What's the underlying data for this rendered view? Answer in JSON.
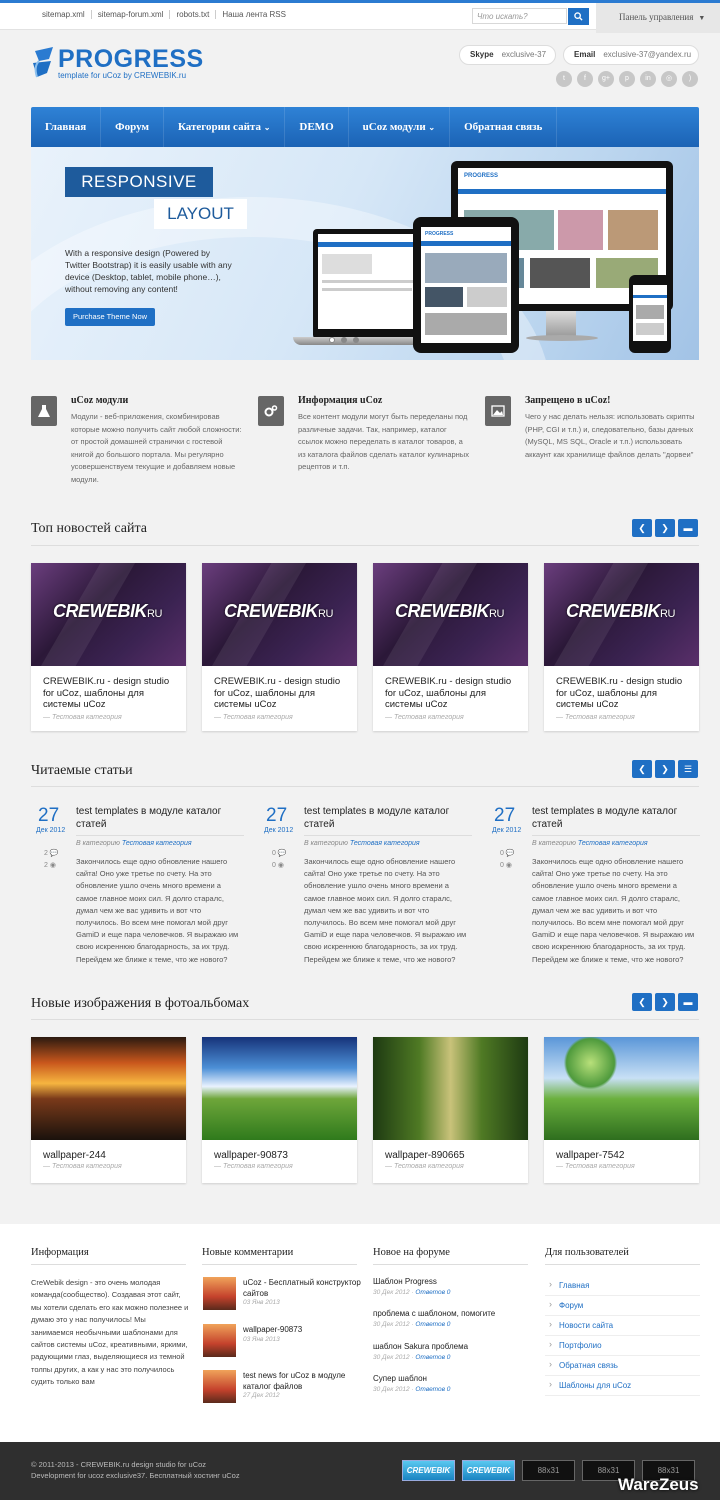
{
  "top": {
    "links": [
      "sitemap.xml",
      "sitemap-forum.xml",
      "robots.txt",
      "Наша лента RSS"
    ],
    "search_placeholder": "Что искать?",
    "panel_label": "Панель управления"
  },
  "brand": {
    "title": "PROGRESS",
    "subtitle": "template for uCoz by CREWEBIK.ru",
    "color": "#1f6fc4"
  },
  "contacts": {
    "skype_label": "Skype",
    "skype_value": "exclusive-37",
    "email_label": "Email",
    "email_value": "exclusive-37@yandex.ru"
  },
  "social_icons": [
    "twitter-icon",
    "facebook-icon",
    "google-plus-icon",
    "pinterest-icon",
    "linkedin-icon",
    "dribbble-icon",
    "rss-icon"
  ],
  "nav": [
    {
      "label": "Главная"
    },
    {
      "label": "Форум"
    },
    {
      "label": "Категории сайта"
    },
    {
      "label": "DEMO"
    },
    {
      "label": "uCoz модули"
    },
    {
      "label": "Обратная связь"
    }
  ],
  "hero": {
    "line1": "RESPONSIVE",
    "line2": "LAYOUT",
    "text": "With a responsive design (Powered by Twitter Bootstrap) it is easily usable with any device (Desktop, tablet, mobile phone…), without removing any content!",
    "button": "Purchase Theme Now",
    "active_slide": 1,
    "slides": 3
  },
  "features": [
    {
      "title": "uCoz модули",
      "text": "Модули - веб-приложения, скомбинировав которые можно получить сайт любой сложности: от простой домашней странички с гостевой книгой до большого портала. Мы регулярно усовершенствуем текущие и добавляем новые модули."
    },
    {
      "title": "Информация uCoz",
      "text": "Все контент модули могут быть переделаны под различные задачи. Так, например, каталог ссылок можно переделать в каталог товаров, а из каталога файлов сделать каталог кулинарных рецептов и т.п."
    },
    {
      "title": "Запрещено в uCoz!",
      "text": "Чего у нас делать нельзя: использовать скрипты (PHP, CGI и т.п.) и, следовательно, базы данных (MySQL, MS SQL, Oracle и т.п.) использовать аккаунт как хранилище файлов делать \"дорвеи\""
    }
  ],
  "top_news": {
    "title": "Топ новостей сайта",
    "items": [
      {
        "logo": "CREWEBIK",
        "logo_suffix": "RU",
        "title": "CREWEBIK.ru - design studio for uCoz, шаблоны для системы uCoz",
        "category": "— Тестовая категория"
      },
      {
        "logo": "CREWEBIK",
        "logo_suffix": "RU",
        "title": "CREWEBIK.ru - design studio for uCoz, шаблоны для системы uCoz",
        "category": "— Тестовая категория"
      },
      {
        "logo": "CREWEBIK",
        "logo_suffix": "RU",
        "title": "CREWEBIK.ru - design studio for uCoz, шаблоны для системы uCoz",
        "category": "— Тестовая категория"
      },
      {
        "logo": "CREWEBIK",
        "logo_suffix": "RU",
        "title": "CREWEBIK.ru - design studio for uCoz, шаблоны для системы uCoz",
        "category": "— Тестовая категория"
      }
    ]
  },
  "articles": {
    "title": "Читаемые статьи",
    "in_category_label": "В категорию",
    "items": [
      {
        "day": "27",
        "month": "Дек 2012",
        "title": "test templates в модуле каталог статей",
        "category": "Тестовая категория",
        "comments": "2",
        "views": "2",
        "text": "Закончилось еще одно обновление нашего сайта! Оно уже третье по счету. На это обновление ушло очень много времени а самое главное моих сил. Я долго старалс, думал чем же вас удивить и вот что получилось. Во всем мне помогал мой друг GamiD и еще пара человечков. Я выражаю им свою искреннюю благодарность, за их труд. Перейдем же ближе к теме, что же нового?"
      },
      {
        "day": "27",
        "month": "Дек 2012",
        "title": "test templates в модуле каталог статей",
        "category": "Тестовая категория",
        "comments": "0",
        "views": "0",
        "text": "Закончилось еще одно обновление нашего сайта! Оно уже третье по счету. На это обновление ушло очень много времени а самое главное моих сил. Я долго старалс, думал чем же вас удивить и вот что получилось. Во всем мне помогал мой друг GamiD и еще пара человечков. Я выражаю им свою искреннюю благодарность, за их труд. Перейдем же ближе к теме, что же нового?"
      },
      {
        "day": "27",
        "month": "Дек 2012",
        "title": "test templates в модуле каталог статей",
        "category": "Тестовая категория",
        "comments": "0",
        "views": "0",
        "text": "Закончилось еще одно обновление нашего сайта! Оно уже третье по счету. На это обновление ушло очень много времени а самое главное моих сил. Я долго старалс, думал чем же вас удивить и вот что получилось. Во всем мне помогал мой друг GamiD и еще пара человечков. Я выражаю им свою искреннюю благодарность, за их труд. Перейдем же ближе к теме, что же нового?"
      }
    ]
  },
  "photos": {
    "title": "Новые изображения в фотоальбомах",
    "items": [
      {
        "title": "wallpaper-244",
        "category": "— Тестовая категория"
      },
      {
        "title": "wallpaper-90873",
        "category": "— Тестовая категория"
      },
      {
        "title": "wallpaper-890665",
        "category": "— Тестовая категория"
      },
      {
        "title": "wallpaper-7542",
        "category": "— Тестовая категория"
      }
    ]
  },
  "footer": {
    "info_title": "Информация",
    "info_text": "CreWebik design - это очень молодая команда(сообщество). Создавая этот сайт, мы хотели сделать его как можно полезнее и думаю это у нас получилось! Мы занимаемся необычными шаблонами для сайтов системы uCoz, креативными, яркими, радующими глаз, выделяющиеся из темной толпы других, а как у нас это получилось судить только вам",
    "comments_title": "Новые комментарии",
    "comments": [
      {
        "title": "uCoz - Бесплатный конструктор сайтов",
        "date": "03 Янв 2013"
      },
      {
        "title": "wallpaper-90873",
        "date": "03 Янв 2013"
      },
      {
        "title": "test news for uCoz в модуле каталог файлов",
        "date": "27 Дек 2012"
      }
    ],
    "forum_title": "Новое на форуме",
    "forum": [
      {
        "title": "Шаблон Progress",
        "date": "30 Дек 2012 · ",
        "answers": "Ответов 0"
      },
      {
        "title": "проблема с шаблоном, помогите",
        "date": "30 Дек 2012 · ",
        "answers": "Ответов 0"
      },
      {
        "title": "шаблон Sakura проблема",
        "date": "30 Дек 2012 · ",
        "answers": "Ответов 0"
      },
      {
        "title": "Супер шаблон",
        "date": "30 Дек 2012 · ",
        "answers": "Ответов 0"
      }
    ],
    "users_title": "Для пользователей",
    "users_links": [
      "Главная",
      "Форум",
      "Новости сайта",
      "Портфолио",
      "Обратная связь",
      "Шаблоны для uCoz"
    ]
  },
  "bottom": {
    "copyright": "© 2011-2013 - CREWEBIK.ru design studio for uCoz",
    "dev": "Development for ucoz exclusive37. Бесплатный хостинг uCoz",
    "badges": [
      "CREWEBIK",
      "CREWEBIK",
      "88x31",
      "88x31",
      "88x31"
    ],
    "watermark": "WareZeus"
  }
}
